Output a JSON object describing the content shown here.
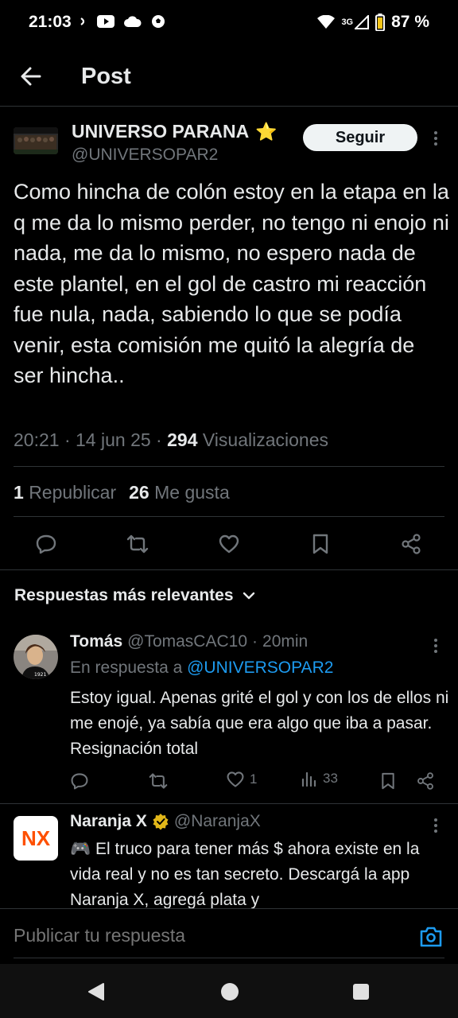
{
  "status_bar": {
    "time": "21:03",
    "network": "3G",
    "battery": "87 %"
  },
  "header": {
    "title": "Post"
  },
  "post": {
    "author_name": "UNIVERSO PARANA",
    "author_emoji": "⭐",
    "author_handle": "@UNIVERSOPAR2",
    "follow_label": "Seguir",
    "text": "Como hincha de colón estoy en la etapa en la q me da lo mismo perder, no tengo ni enojo ni nada, me da lo mismo, no espero nada de este plantel, en el gol de castro mi reacción fue nula, nada, sabiendo lo que se podía venir, esta comisión me quitó la alegría de ser hincha..",
    "time": "20:21",
    "date": "14 jun 25",
    "views_count": "294",
    "views_label": "Visualizaciones",
    "reposts_count": "1",
    "reposts_label": "Republicar",
    "likes_count": "26",
    "likes_label": "Me gusta"
  },
  "replies_section": {
    "heading": "Respuestas más relevantes"
  },
  "replies": [
    {
      "name": "Tomás",
      "handle": "@TomasCAC10",
      "separator": "·",
      "time": "20min",
      "in_reply_prefix": "En respuesta a",
      "in_reply_mention": "@UNIVERSOPAR2",
      "text": "Estoy igual. Apenas grité el gol y con los de ellos ni me enojé, ya sabía que era algo que iba a pasar. Resignación total",
      "likes": "1",
      "views": "33"
    }
  ],
  "ad": {
    "avatar_text": "NX",
    "name": "Naranja X",
    "handle": "@NaranjaX",
    "text": "🎮 El truco para tener más $ ahora existe en la vida real y no es tan secreto. Descargá la app Naranja X, agregá plata y"
  },
  "compose": {
    "placeholder": "Publicar tu respuesta"
  },
  "colors": {
    "background": "#000000",
    "text": "#e7e9ea",
    "muted": "#71767b",
    "accent": "#1d9bf0",
    "divider": "#2f3336",
    "verified_gold": "#e2b719",
    "naranja": "#fe5000"
  }
}
